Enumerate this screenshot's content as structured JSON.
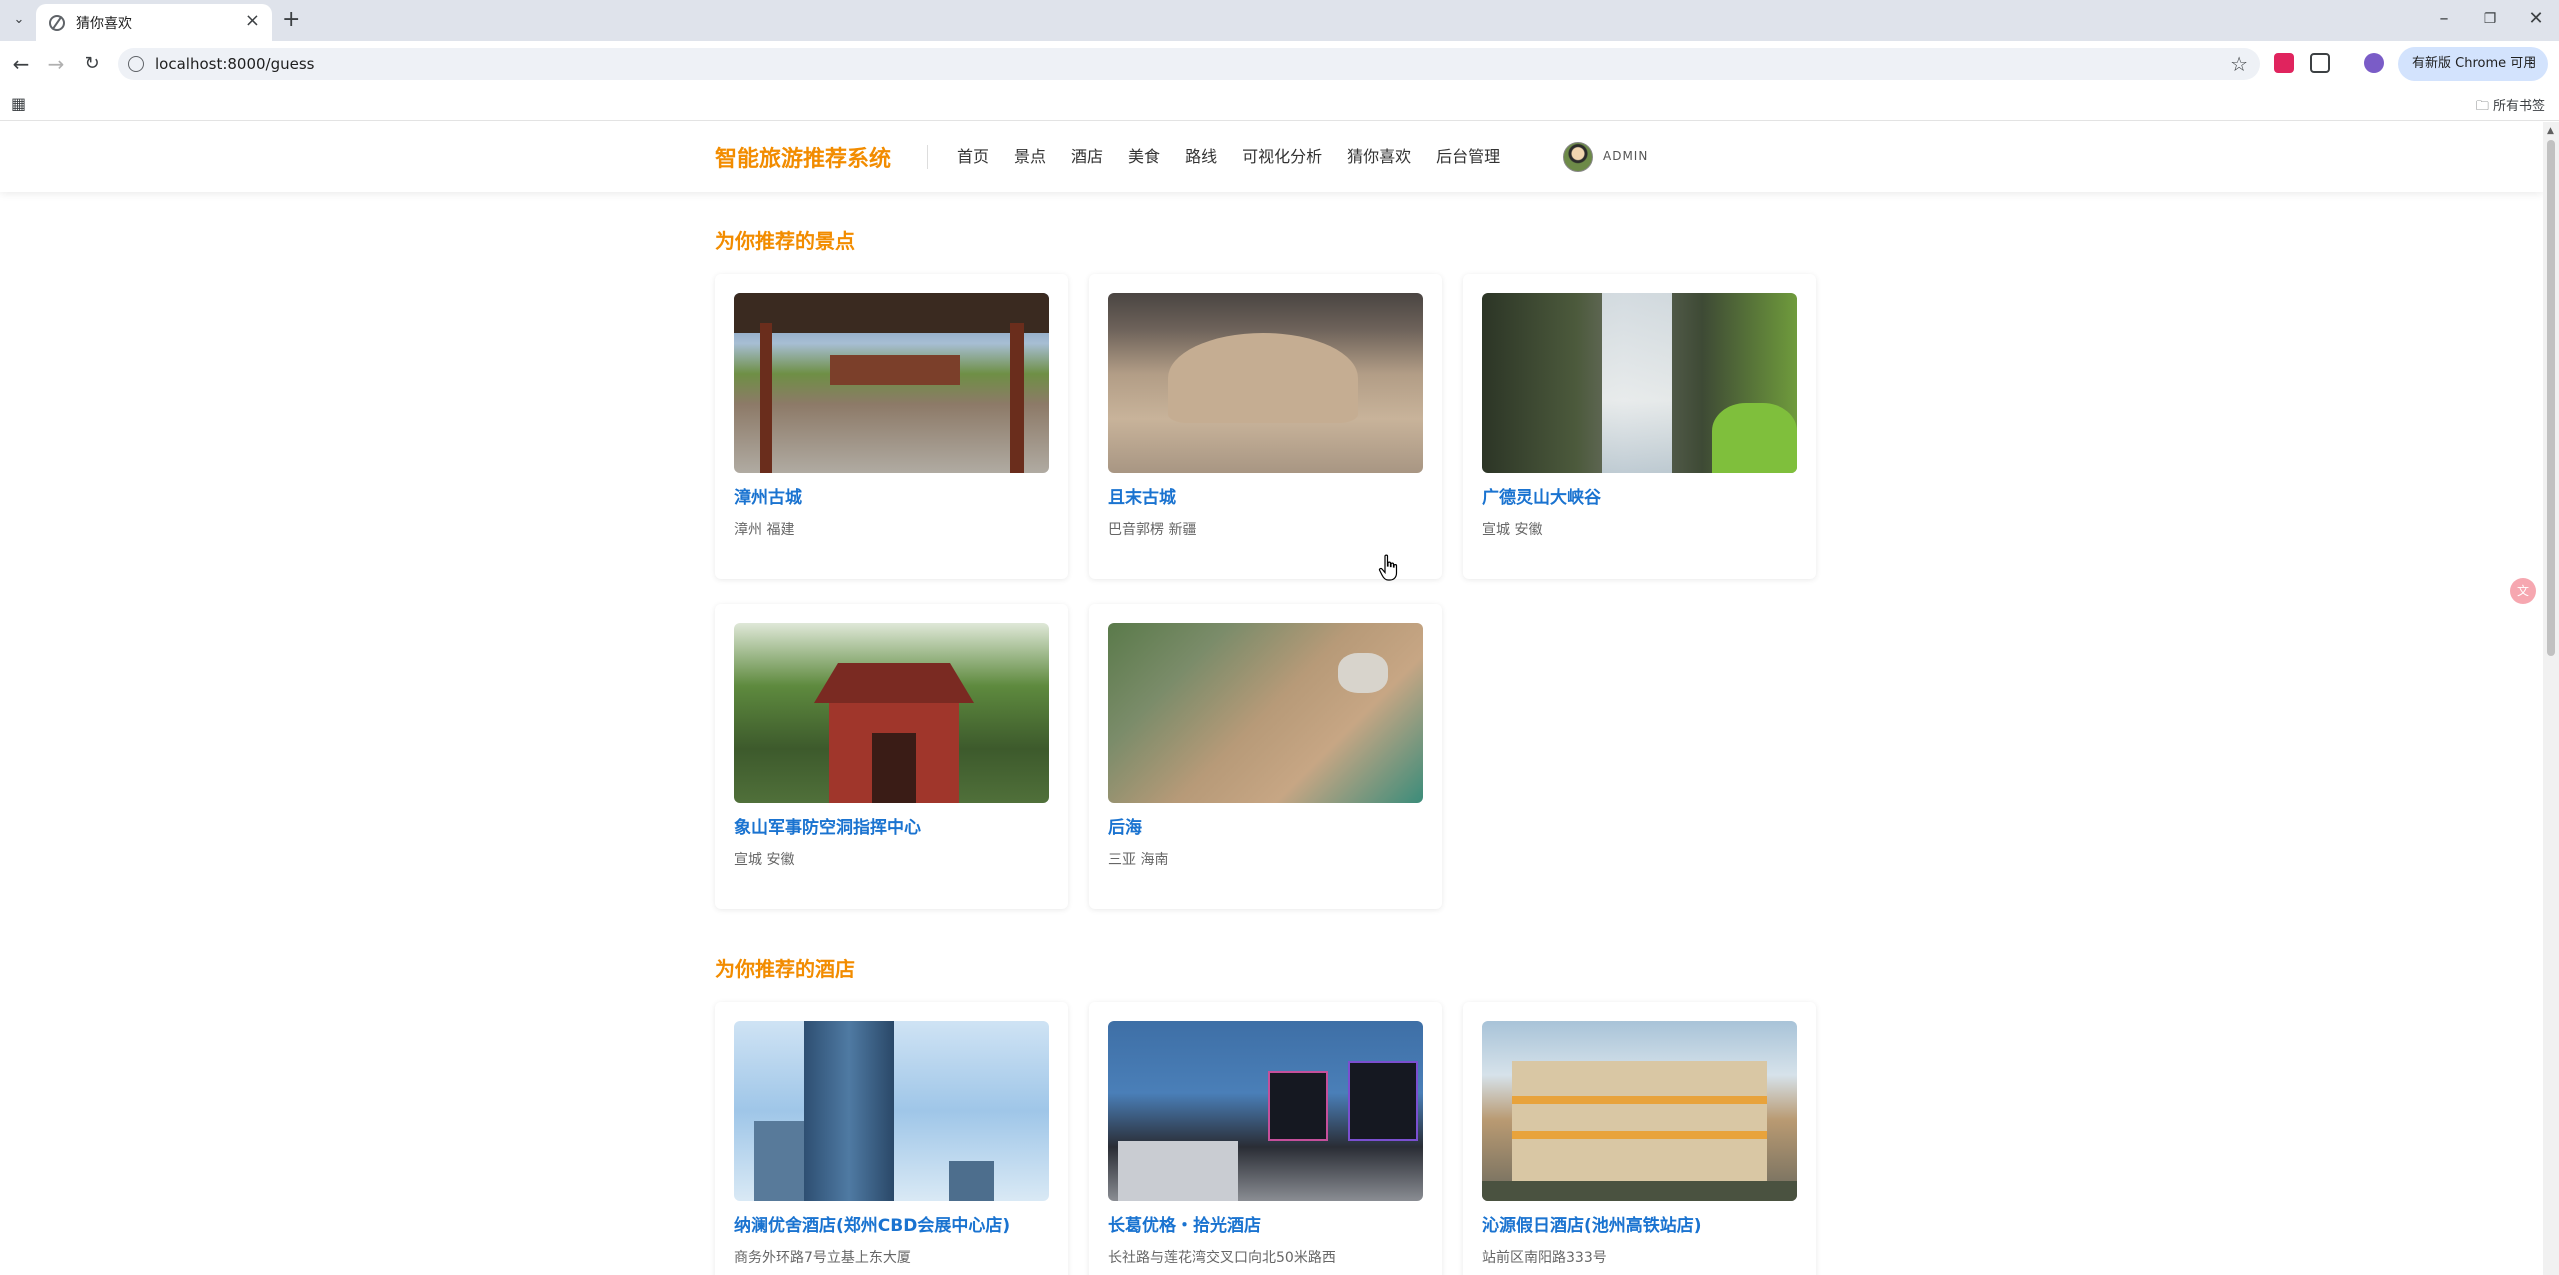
{
  "browser": {
    "tab_title": "猜你喜欢",
    "url": "localhost:8000/guess",
    "update_label": "有新版 Chrome 可用",
    "all_bookmarks_label": "所有书签"
  },
  "site": {
    "logo": "智能旅游推荐系统",
    "nav": [
      "首页",
      "景点",
      "酒店",
      "美食",
      "路线",
      "可视化分析",
      "猜你喜欢",
      "后台管理"
    ],
    "user_name": "ADMIN"
  },
  "sections": {
    "spots_title": "为你推荐的景点",
    "hotels_title": "为你推荐的酒店"
  },
  "spots": [
    {
      "name": "漳州古城",
      "location": "漳州 福建"
    },
    {
      "name": "且末古城",
      "location": "巴音郭楞 新疆"
    },
    {
      "name": "广德灵山大峡谷",
      "location": "宣城 安徽"
    },
    {
      "name": "象山军事防空洞指挥中心",
      "location": "宣城 安徽"
    },
    {
      "name": "后海",
      "location": "三亚 海南"
    }
  ],
  "hotels": [
    {
      "name": "纳澜优舍酒店(郑州CBD会展中心店)",
      "address": "商务外环路7号立基上东大厦"
    },
    {
      "name": "长葛优格・拾光酒店",
      "address": "长社路与莲花湾交叉口向北50米路西"
    },
    {
      "name": "沁源假日酒店(池州高铁站店)",
      "address": "站前区南阳路333号"
    }
  ],
  "colors": {
    "brand_orange": "#f28c00",
    "link_blue": "#1a73d0"
  }
}
